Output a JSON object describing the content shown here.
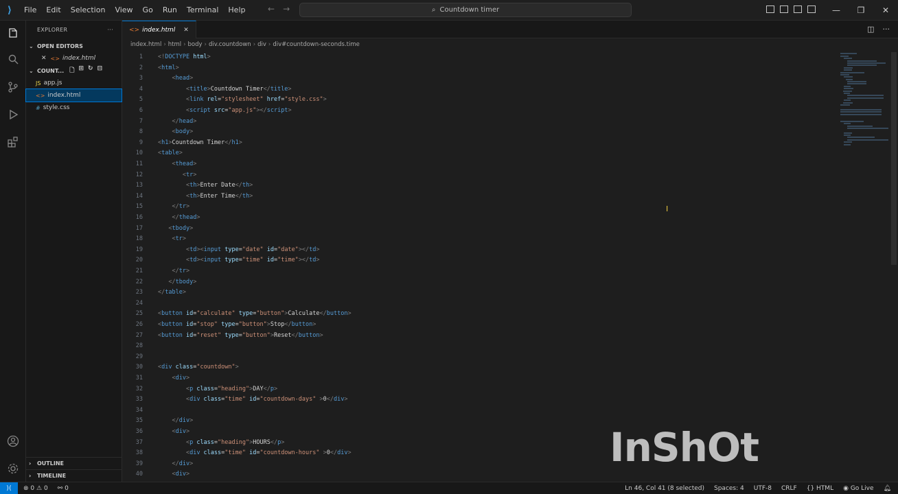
{
  "titlebar": {
    "menu": [
      "File",
      "Edit",
      "Selection",
      "View",
      "Go",
      "Run",
      "Terminal",
      "Help"
    ],
    "search": "Countdown timer"
  },
  "sidebar": {
    "header": "EXPLORER",
    "open_editors_label": "OPEN EDITORS",
    "open_editor_file": "index.html",
    "folder_label": "COUNT...",
    "files": [
      {
        "name": "app.js",
        "icon": "JS"
      },
      {
        "name": "index.html",
        "icon": "<>"
      },
      {
        "name": "style.css",
        "icon": "#"
      }
    ],
    "outline_label": "OUTLINE",
    "timeline_label": "TIMELINE"
  },
  "editor": {
    "tab_label": "index.html",
    "breadcrumb": [
      "index.html",
      "html",
      "body",
      "div.countdown",
      "div",
      "div#countdown-seconds.time"
    ]
  },
  "code_lines": [
    {
      "n": "1",
      "indent": 0,
      "parts": [
        [
          "br",
          "<!"
        ],
        [
          "tag",
          "DOCTYPE"
        ],
        [
          "attr",
          " html"
        ],
        [
          "br",
          ">"
        ]
      ]
    },
    {
      "n": "2",
      "indent": 0,
      "parts": [
        [
          "br",
          "<"
        ],
        [
          "tag",
          "html"
        ],
        [
          "br",
          ">"
        ]
      ]
    },
    {
      "n": "3",
      "indent": 4,
      "parts": [
        [
          "br",
          "<"
        ],
        [
          "tag",
          "head"
        ],
        [
          "br",
          ">"
        ]
      ]
    },
    {
      "n": "4",
      "indent": 8,
      "parts": [
        [
          "br",
          "<"
        ],
        [
          "tag",
          "title"
        ],
        [
          "br",
          ">"
        ],
        [
          "txt",
          "Countdown Timer"
        ],
        [
          "br",
          "</"
        ],
        [
          "tag",
          "title"
        ],
        [
          "br",
          ">"
        ]
      ]
    },
    {
      "n": "5",
      "indent": 8,
      "parts": [
        [
          "br",
          "<"
        ],
        [
          "tag",
          "link"
        ],
        [
          "attr",
          " rel"
        ],
        [
          "txt",
          "="
        ],
        [
          "str",
          "\"stylesheet\""
        ],
        [
          "attr",
          " href"
        ],
        [
          "txt",
          "="
        ],
        [
          "str",
          "\"style.css\""
        ],
        [
          "br",
          ">"
        ]
      ]
    },
    {
      "n": "6",
      "indent": 8,
      "parts": [
        [
          "br",
          "<"
        ],
        [
          "tag",
          "script"
        ],
        [
          "attr",
          " src"
        ],
        [
          "txt",
          "="
        ],
        [
          "str",
          "\"app.js\""
        ],
        [
          "br",
          "></"
        ],
        [
          "tag",
          "script"
        ],
        [
          "br",
          ">"
        ]
      ]
    },
    {
      "n": "7",
      "indent": 4,
      "parts": [
        [
          "br",
          "</"
        ],
        [
          "tag",
          "head"
        ],
        [
          "br",
          ">"
        ]
      ]
    },
    {
      "n": "8",
      "indent": 4,
      "parts": [
        [
          "br",
          "<"
        ],
        [
          "tag",
          "body"
        ],
        [
          "br",
          ">"
        ]
      ]
    },
    {
      "n": "9",
      "indent": 0,
      "parts": [
        [
          "br",
          "<"
        ],
        [
          "tag",
          "h1"
        ],
        [
          "br",
          ">"
        ],
        [
          "txt",
          "Countdown Timer"
        ],
        [
          "br",
          "</"
        ],
        [
          "tag",
          "h1"
        ],
        [
          "br",
          ">"
        ]
      ]
    },
    {
      "n": "10",
      "indent": 0,
      "parts": [
        [
          "br",
          "<"
        ],
        [
          "tag",
          "table"
        ],
        [
          "br",
          ">"
        ]
      ]
    },
    {
      "n": "11",
      "indent": 4,
      "parts": [
        [
          "br",
          "<"
        ],
        [
          "tag",
          "thead"
        ],
        [
          "br",
          ">"
        ]
      ]
    },
    {
      "n": "12",
      "indent": 7,
      "parts": [
        [
          "br",
          "<"
        ],
        [
          "tag",
          "tr"
        ],
        [
          "br",
          ">"
        ]
      ]
    },
    {
      "n": "13",
      "indent": 8,
      "parts": [
        [
          "br",
          "<"
        ],
        [
          "tag",
          "th"
        ],
        [
          "br",
          ">"
        ],
        [
          "txt",
          "Enter Date"
        ],
        [
          "br",
          "</"
        ],
        [
          "tag",
          "th"
        ],
        [
          "br",
          ">"
        ]
      ]
    },
    {
      "n": "14",
      "indent": 8,
      "parts": [
        [
          "br",
          "<"
        ],
        [
          "tag",
          "th"
        ],
        [
          "br",
          ">"
        ],
        [
          "txt",
          "Enter Time"
        ],
        [
          "br",
          "</"
        ],
        [
          "tag",
          "th"
        ],
        [
          "br",
          ">"
        ]
      ]
    },
    {
      "n": "15",
      "indent": 4,
      "parts": [
        [
          "br",
          "</"
        ],
        [
          "tag",
          "tr"
        ],
        [
          "br",
          ">"
        ]
      ]
    },
    {
      "n": "16",
      "indent": 4,
      "parts": [
        [
          "br",
          "</"
        ],
        [
          "tag",
          "thead"
        ],
        [
          "br",
          ">"
        ]
      ]
    },
    {
      "n": "17",
      "indent": 3,
      "parts": [
        [
          "br",
          "<"
        ],
        [
          "tag",
          "tbody"
        ],
        [
          "br",
          ">"
        ]
      ]
    },
    {
      "n": "18",
      "indent": 4,
      "parts": [
        [
          "br",
          "<"
        ],
        [
          "tag",
          "tr"
        ],
        [
          "br",
          ">"
        ]
      ]
    },
    {
      "n": "19",
      "indent": 8,
      "parts": [
        [
          "br",
          "<"
        ],
        [
          "tag",
          "td"
        ],
        [
          "br",
          "><"
        ],
        [
          "tag",
          "input"
        ],
        [
          "attr",
          " type"
        ],
        [
          "txt",
          "="
        ],
        [
          "str",
          "\"date\""
        ],
        [
          "attr",
          " id"
        ],
        [
          "txt",
          "="
        ],
        [
          "str",
          "\"date\""
        ],
        [
          "br",
          "></"
        ],
        [
          "tag",
          "td"
        ],
        [
          "br",
          ">"
        ]
      ]
    },
    {
      "n": "20",
      "indent": 8,
      "parts": [
        [
          "br",
          "<"
        ],
        [
          "tag",
          "td"
        ],
        [
          "br",
          "><"
        ],
        [
          "tag",
          "input"
        ],
        [
          "attr",
          " type"
        ],
        [
          "txt",
          "="
        ],
        [
          "str",
          "\"time\""
        ],
        [
          "attr",
          " id"
        ],
        [
          "txt",
          "="
        ],
        [
          "str",
          "\"time\""
        ],
        [
          "br",
          "></"
        ],
        [
          "tag",
          "td"
        ],
        [
          "br",
          ">"
        ]
      ]
    },
    {
      "n": "21",
      "indent": 4,
      "parts": [
        [
          "br",
          "</"
        ],
        [
          "tag",
          "tr"
        ],
        [
          "br",
          ">"
        ]
      ]
    },
    {
      "n": "22",
      "indent": 3,
      "parts": [
        [
          "br",
          "</"
        ],
        [
          "tag",
          "tbody"
        ],
        [
          "br",
          ">"
        ]
      ]
    },
    {
      "n": "23",
      "indent": 0,
      "parts": [
        [
          "br",
          "</"
        ],
        [
          "tag",
          "table"
        ],
        [
          "br",
          ">"
        ]
      ]
    },
    {
      "n": "24",
      "indent": 0,
      "parts": []
    },
    {
      "n": "25",
      "indent": 0,
      "parts": [
        [
          "br",
          "<"
        ],
        [
          "tag",
          "button"
        ],
        [
          "attr",
          " id"
        ],
        [
          "txt",
          "="
        ],
        [
          "str",
          "\"calculate\""
        ],
        [
          "attr",
          " type"
        ],
        [
          "txt",
          "="
        ],
        [
          "str",
          "\"button\""
        ],
        [
          "br",
          ">"
        ],
        [
          "txt",
          "Calculate"
        ],
        [
          "br",
          "</"
        ],
        [
          "tag",
          "button"
        ],
        [
          "br",
          ">"
        ]
      ]
    },
    {
      "n": "26",
      "indent": 0,
      "parts": [
        [
          "br",
          "<"
        ],
        [
          "tag",
          "button"
        ],
        [
          "attr",
          " id"
        ],
        [
          "txt",
          "="
        ],
        [
          "str",
          "\"stop\""
        ],
        [
          "attr",
          " type"
        ],
        [
          "txt",
          "="
        ],
        [
          "str",
          "\"button\""
        ],
        [
          "br",
          ">"
        ],
        [
          "txt",
          "Stop"
        ],
        [
          "br",
          "</"
        ],
        [
          "tag",
          "button"
        ],
        [
          "br",
          ">"
        ]
      ]
    },
    {
      "n": "27",
      "indent": 0,
      "parts": [
        [
          "br",
          "<"
        ],
        [
          "tag",
          "button"
        ],
        [
          "attr",
          " id"
        ],
        [
          "txt",
          "="
        ],
        [
          "str",
          "\"reset\""
        ],
        [
          "attr",
          " type"
        ],
        [
          "txt",
          "="
        ],
        [
          "str",
          "\"button\""
        ],
        [
          "br",
          ">"
        ],
        [
          "txt",
          "Reset"
        ],
        [
          "br",
          "</"
        ],
        [
          "tag",
          "button"
        ],
        [
          "br",
          ">"
        ]
      ]
    },
    {
      "n": "28",
      "indent": 0,
      "parts": []
    },
    {
      "n": "29",
      "indent": 0,
      "parts": []
    },
    {
      "n": "30",
      "indent": 0,
      "parts": [
        [
          "br",
          "<"
        ],
        [
          "tag",
          "div"
        ],
        [
          "attr",
          " class"
        ],
        [
          "txt",
          "="
        ],
        [
          "str",
          "\"countdown\""
        ],
        [
          "br",
          ">"
        ]
      ]
    },
    {
      "n": "31",
      "indent": 4,
      "parts": [
        [
          "br",
          "<"
        ],
        [
          "tag",
          "div"
        ],
        [
          "br",
          ">"
        ]
      ]
    },
    {
      "n": "32",
      "indent": 8,
      "parts": [
        [
          "br",
          "<"
        ],
        [
          "tag",
          "p"
        ],
        [
          "attr",
          " class"
        ],
        [
          "txt",
          "="
        ],
        [
          "str",
          "\"heading\""
        ],
        [
          "br",
          ">"
        ],
        [
          "txt",
          "DAY"
        ],
        [
          "br",
          "</"
        ],
        [
          "tag",
          "p"
        ],
        [
          "br",
          ">"
        ]
      ]
    },
    {
      "n": "33",
      "indent": 8,
      "parts": [
        [
          "br",
          "<"
        ],
        [
          "tag",
          "div"
        ],
        [
          "attr",
          " class"
        ],
        [
          "txt",
          "="
        ],
        [
          "str",
          "\"time\""
        ],
        [
          "attr",
          " id"
        ],
        [
          "txt",
          "="
        ],
        [
          "str",
          "\"countdown-days\""
        ],
        [
          "br",
          " >"
        ],
        [
          "txt",
          "0"
        ],
        [
          "br",
          "</"
        ],
        [
          "tag",
          "div"
        ],
        [
          "br",
          ">"
        ]
      ]
    },
    {
      "n": "34",
      "indent": 0,
      "parts": []
    },
    {
      "n": "35",
      "indent": 4,
      "parts": [
        [
          "br",
          "</"
        ],
        [
          "tag",
          "div"
        ],
        [
          "br",
          ">"
        ]
      ]
    },
    {
      "n": "36",
      "indent": 4,
      "parts": [
        [
          "br",
          "<"
        ],
        [
          "tag",
          "div"
        ],
        [
          "br",
          ">"
        ]
      ]
    },
    {
      "n": "37",
      "indent": 8,
      "parts": [
        [
          "br",
          "<"
        ],
        [
          "tag",
          "p"
        ],
        [
          "attr",
          " class"
        ],
        [
          "txt",
          "="
        ],
        [
          "str",
          "\"heading\""
        ],
        [
          "br",
          ">"
        ],
        [
          "txt",
          "HOURS"
        ],
        [
          "br",
          "</"
        ],
        [
          "tag",
          "p"
        ],
        [
          "br",
          ">"
        ]
      ]
    },
    {
      "n": "38",
      "indent": 8,
      "parts": [
        [
          "br",
          "<"
        ],
        [
          "tag",
          "div"
        ],
        [
          "attr",
          " class"
        ],
        [
          "txt",
          "="
        ],
        [
          "str",
          "\"time\""
        ],
        [
          "attr",
          " id"
        ],
        [
          "txt",
          "="
        ],
        [
          "str",
          "\"countdown-hours\""
        ],
        [
          "br",
          " >"
        ],
        [
          "txt",
          "0"
        ],
        [
          "br",
          "</"
        ],
        [
          "tag",
          "div"
        ],
        [
          "br",
          ">"
        ]
      ]
    },
    {
      "n": "39",
      "indent": 4,
      "parts": [
        [
          "br",
          "</"
        ],
        [
          "tag",
          "div"
        ],
        [
          "br",
          ">"
        ]
      ]
    },
    {
      "n": "40",
      "indent": 4,
      "parts": [
        [
          "br",
          "<"
        ],
        [
          "tag",
          "div"
        ],
        [
          "br",
          ">"
        ]
      ]
    }
  ],
  "statusbar": {
    "errors": "0",
    "warnings": "0",
    "ports": "0",
    "cursor": "Ln 46, Col 41 (8 selected)",
    "spaces": "Spaces: 4",
    "encoding": "UTF-8",
    "eol": "CRLF",
    "language": "HTML",
    "golive": "Go Live"
  },
  "watermark": "InShOt",
  "colors": {
    "accent": "#0078d4",
    "tag": "#569cd6",
    "attr": "#9cdcfe",
    "string": "#ce9178"
  }
}
